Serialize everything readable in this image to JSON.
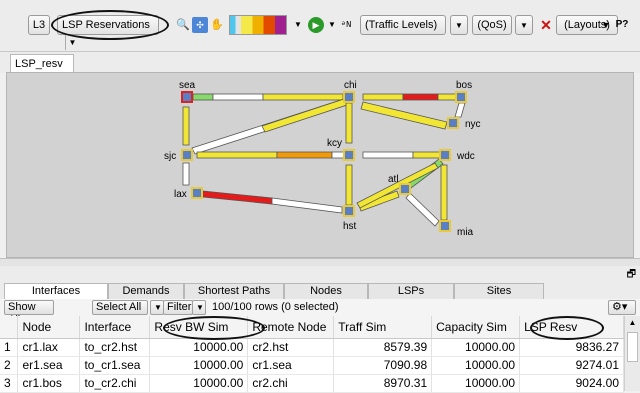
{
  "toolbar": {
    "layer_label": "L3",
    "view_select": "LSP Reservations",
    "traffic_levels": "(Traffic Levels)",
    "qos": "(QoS)",
    "layouts": "(Layouts)",
    "icons": [
      "magnify-icon",
      "fit-view-icon",
      "hand-icon",
      "color-scale-icon",
      "play-icon",
      "name-icon",
      "close-icon",
      "layer-p-icon",
      "help-icon"
    ]
  },
  "tabs": {
    "map_tab": "LSP_resv"
  },
  "map": {
    "nodes": [
      {
        "id": "sea",
        "label": "sea",
        "selected": true
      },
      {
        "id": "chi",
        "label": "chi"
      },
      {
        "id": "bos",
        "label": "bos"
      },
      {
        "id": "nyc",
        "label": "nyc"
      },
      {
        "id": "sjc",
        "label": "sjc"
      },
      {
        "id": "kcy",
        "label": "kcy"
      },
      {
        "id": "wdc",
        "label": "wdc"
      },
      {
        "id": "lax",
        "label": "lax"
      },
      {
        "id": "atl",
        "label": "atl"
      },
      {
        "id": "hst",
        "label": "hst"
      },
      {
        "id": "mia",
        "label": "mia"
      }
    ]
  },
  "bottom_tabs": [
    "Interfaces",
    "Demands",
    "Shortest Paths",
    "Nodes",
    "LSPs",
    "Sites"
  ],
  "filterbar": {
    "show_all": "Show All",
    "select_all": "Select All",
    "filter": "Filter",
    "status": "100/100 rows (0 selected)"
  },
  "table": {
    "columns": [
      "",
      "Node",
      "Interface",
      "Resv BW Sim",
      "Remote Node",
      "Traff Sim",
      "Capacity Sim",
      "LSP Resv"
    ],
    "rows": [
      [
        "1",
        "cr1.lax",
        "to_cr2.hst",
        "10000.00",
        "cr2.hst",
        "8579.39",
        "10000.00",
        "9836.27"
      ],
      [
        "2",
        "er1.sea",
        "to_cr1.sea",
        "10000.00",
        "cr1.sea",
        "7090.98",
        "10000.00",
        "9274.01"
      ],
      [
        "3",
        "cr1.bos",
        "to_cr2.chi",
        "10000.00",
        "cr2.chi",
        "8970.31",
        "10000.00",
        "9024.00"
      ]
    ]
  }
}
